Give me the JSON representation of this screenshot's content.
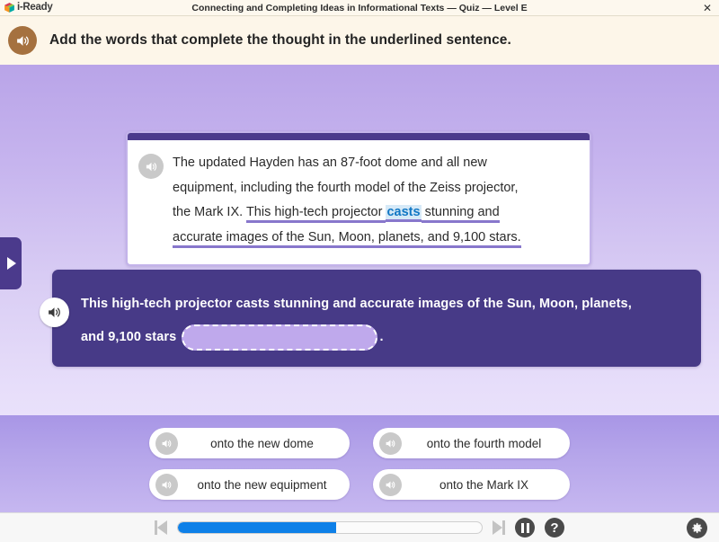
{
  "titlebar": {
    "brand": "i-Ready",
    "brand_icon": "cube-logo-icon",
    "title": "Connecting and Completing Ideas in Informational Texts — Quiz — Level E",
    "close_label": "✕"
  },
  "instruction": {
    "speaker_icon": "speaker-icon",
    "text": "Add the words that complete the thought in the underlined sentence."
  },
  "side_tab": {
    "icon": "chevron-right-icon"
  },
  "passage": {
    "speaker_icon": "speaker-icon",
    "line1": "The updated Hayden has an 87-foot dome and all new",
    "line2": "equipment, including the fourth model of the Zeiss projector,",
    "line3_plain": "the Mark IX. ",
    "line3_underline_a": "This high-tech projector ",
    "line3_keyword": "casts",
    "line3_underline_b": " stunning and",
    "line4_underline": "accurate images of the Sun, Moon, planets, and 9,100 stars.",
    "accent_color": "#4b3a8c",
    "keyword_color": "#1177c4",
    "underline_color": "#8877cc"
  },
  "sentence_panel": {
    "speaker_icon": "speaker-icon",
    "line1": "This high-tech projector casts stunning and accurate images of the Sun, Moon, planets,",
    "line2_before": "and 9,100 stars",
    "line2_after": ".",
    "dropzone_value": "",
    "panel_color": "#473a87",
    "dropzone_fill": "#bfa9ec"
  },
  "choices": [
    {
      "label": "onto the new dome",
      "speaker_icon": "speaker-icon"
    },
    {
      "label": "onto the fourth model",
      "speaker_icon": "speaker-icon"
    },
    {
      "label": "onto the new equipment",
      "speaker_icon": "speaker-icon"
    },
    {
      "label": "onto the Mark IX",
      "speaker_icon": "speaker-icon"
    }
  ],
  "toolbar": {
    "prev_icon": "skip-previous-icon",
    "next_icon": "skip-next-icon",
    "pause_icon": "pause-icon",
    "help_icon": "help-icon",
    "settings_icon": "gear-icon",
    "progress_percent": 52,
    "progress_color": "#0e80e8"
  }
}
